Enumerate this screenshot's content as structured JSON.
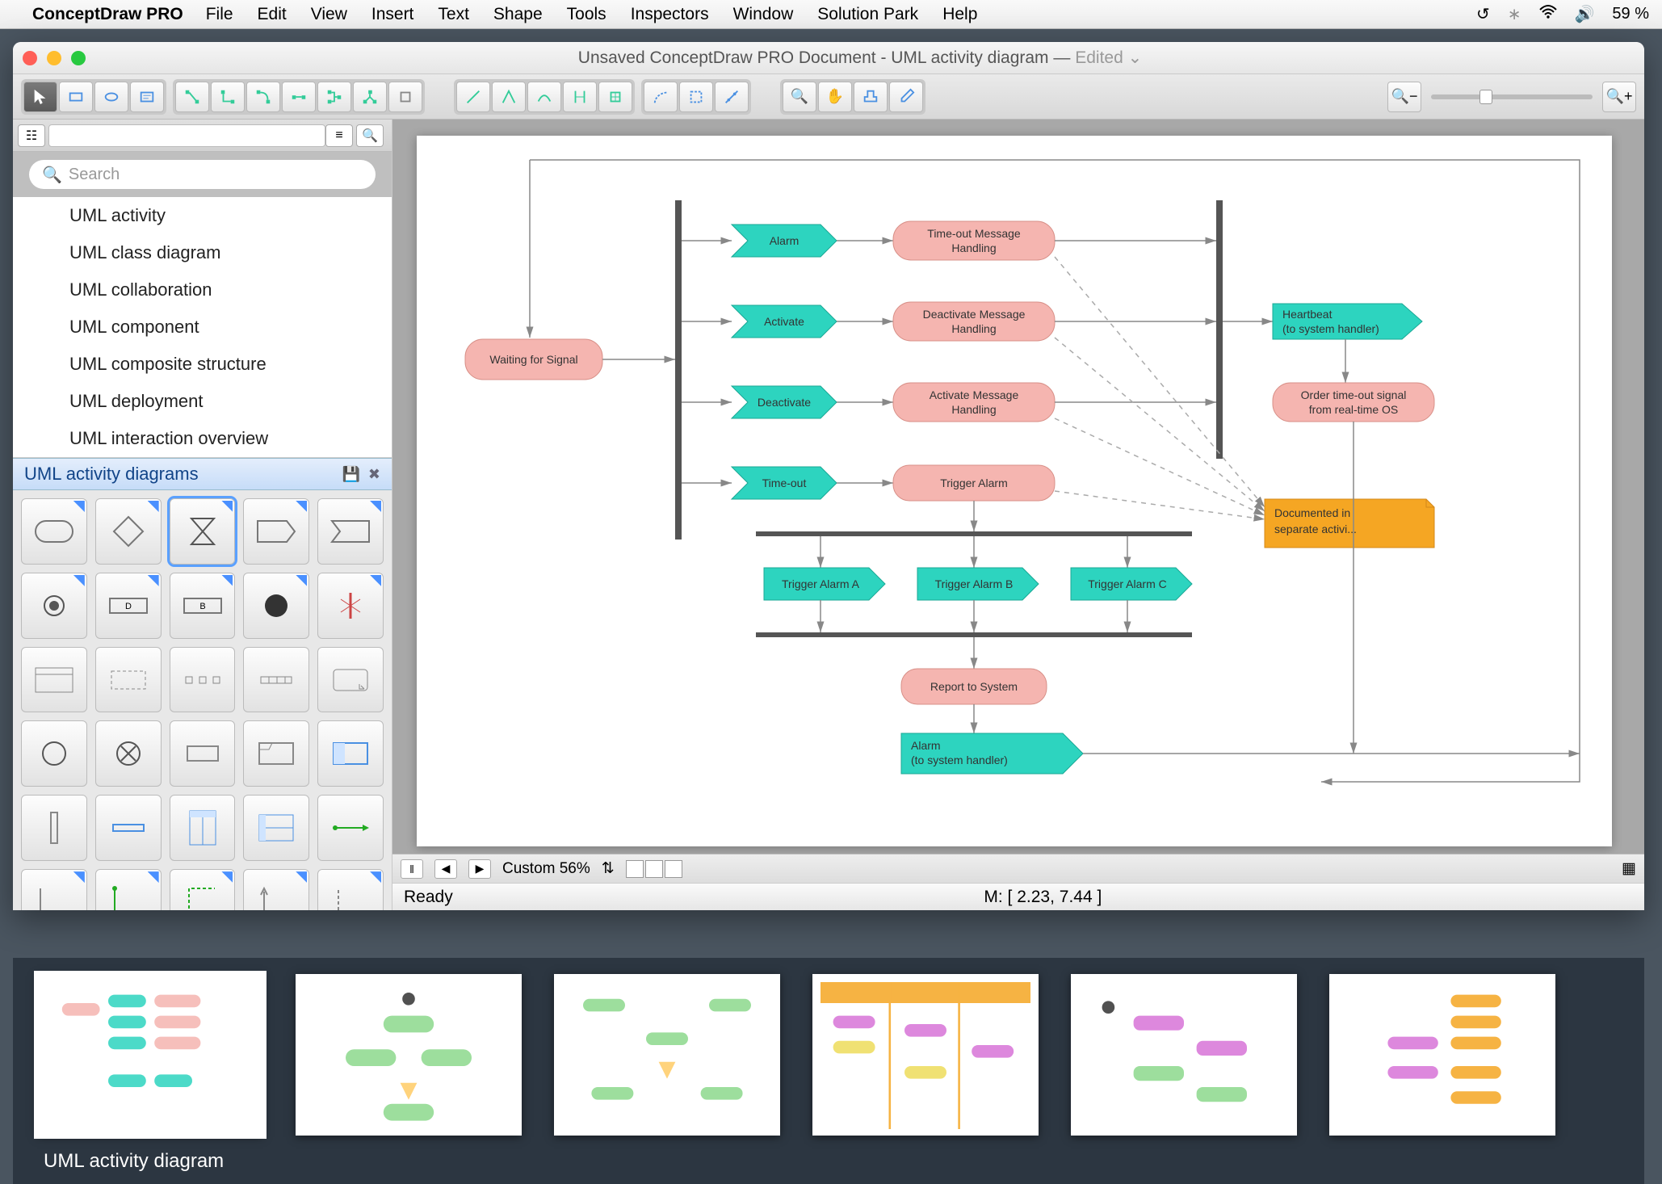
{
  "menubar": {
    "app": "ConceptDraw PRO",
    "items": [
      "File",
      "Edit",
      "View",
      "Insert",
      "Text",
      "Shape",
      "Tools",
      "Inspectors",
      "Window",
      "Solution Park",
      "Help"
    ],
    "battery": "59 %"
  },
  "window": {
    "title_left": "Unsaved ConceptDraw PRO Document - UML activity diagram — ",
    "title_edited": "Edited"
  },
  "sidebar": {
    "search_placeholder": "Search",
    "libs": [
      "UML activity",
      "UML class diagram",
      "UML collaboration",
      "UML component",
      "UML composite structure",
      "UML deployment",
      "UML interaction overview"
    ],
    "stencil_title": "UML activity diagrams"
  },
  "diagram": {
    "waiting": "Waiting for Signal",
    "alarm": "Alarm",
    "activate": "Activate",
    "deactivate": "Deactivate",
    "timeout": "Time-out",
    "timeout_msg_l1": "Time-out Message",
    "timeout_msg_l2": "Handling",
    "deact_msg_l1": "Deactivate Message",
    "deact_msg_l2": "Handling",
    "act_msg_l1": "Activate Message",
    "act_msg_l2": "Handling",
    "trigger": "Trigger Alarm",
    "ta": "Trigger Alarm A",
    "tb": "Trigger Alarm B",
    "tc": "Trigger Alarm C",
    "report": "Report to System",
    "alarm_out_l1": "Alarm",
    "alarm_out_l2": "(to system handler)",
    "heartbeat_l1": "Heartbeat",
    "heartbeat_l2": "(to system handler)",
    "order_l1": "Order time-out signal",
    "order_l2": "from real-time OS",
    "note_l1": "Documented in",
    "note_l2": "separate activi..."
  },
  "canvasbar": {
    "zoom_label": "Custom 56%"
  },
  "statusbar": {
    "ready": "Ready",
    "coord": "M: [ 2.23, 7.44 ]"
  },
  "gallery": {
    "caption": "UML activity diagram"
  }
}
